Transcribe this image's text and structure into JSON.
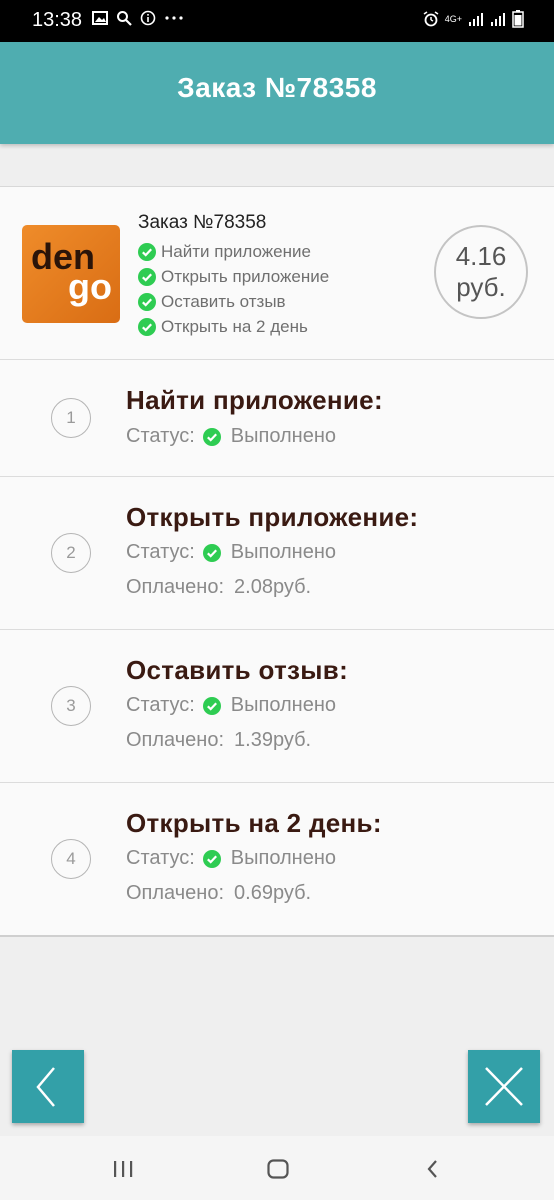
{
  "status_bar": {
    "time": "13:38",
    "network": "4G+"
  },
  "app_bar": {
    "title": "Заказ №78358"
  },
  "order": {
    "title": "Заказ №78358",
    "logo_text_top": "den",
    "logo_text_bottom": "go",
    "price_value": "4.16",
    "price_unit": "руб.",
    "checklist": [
      "Найти приложение",
      "Открыть приложение",
      "Оставить отзыв",
      "Открыть на 2 день"
    ]
  },
  "steps": [
    {
      "num": "1",
      "title": "Найти приложение:",
      "status_label": "Статус:",
      "status_value": "Выполнено"
    },
    {
      "num": "2",
      "title": "Открыть приложение:",
      "status_label": "Статус:",
      "status_value": "Выполнено",
      "paid_label": "Оплачено:",
      "paid_value": "2.08руб."
    },
    {
      "num": "3",
      "title": "Оставить отзыв:",
      "status_label": "Статус:",
      "status_value": "Выполнено",
      "paid_label": "Оплачено:",
      "paid_value": "1.39руб."
    },
    {
      "num": "4",
      "title": "Открыть на 2 день:",
      "status_label": "Статус:",
      "status_value": "Выполнено",
      "paid_label": "Оплачено:",
      "paid_value": "0.69руб."
    }
  ],
  "buttons": {
    "back_icon": "chevron-left-icon",
    "close_icon": "close-icon"
  },
  "colors": {
    "accent": "#4fadb0",
    "button": "#33a0a8",
    "check": "#2ecc52",
    "step_title": "#3a1a12",
    "logo": "#e67e22"
  }
}
